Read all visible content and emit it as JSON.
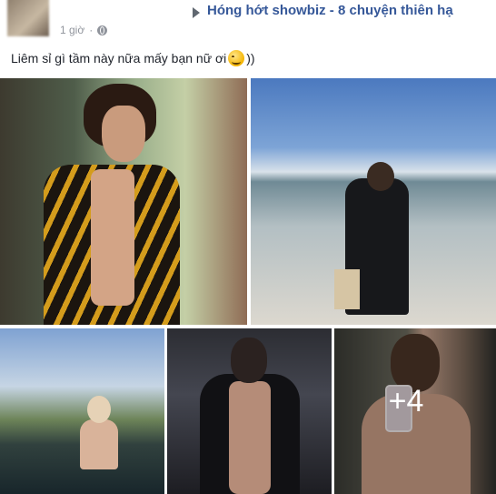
{
  "header": {
    "group_name": "Hóng hớt showbiz - 8 chuyện thiên hạ",
    "time": "1 giờ",
    "dot": "·"
  },
  "post": {
    "text": "Liêm sỉ gì tầm này nữa mấy bạn nữ ơi",
    "text_suffix": "))"
  },
  "photos": {
    "more_count": "+4"
  },
  "icons": {
    "group_arrow": "triangle-right-icon",
    "privacy": "globe-icon",
    "emoji": "smiling-face-icon"
  },
  "colors": {
    "link": "#365899",
    "meta": "#90949c",
    "text": "#1d2129"
  }
}
